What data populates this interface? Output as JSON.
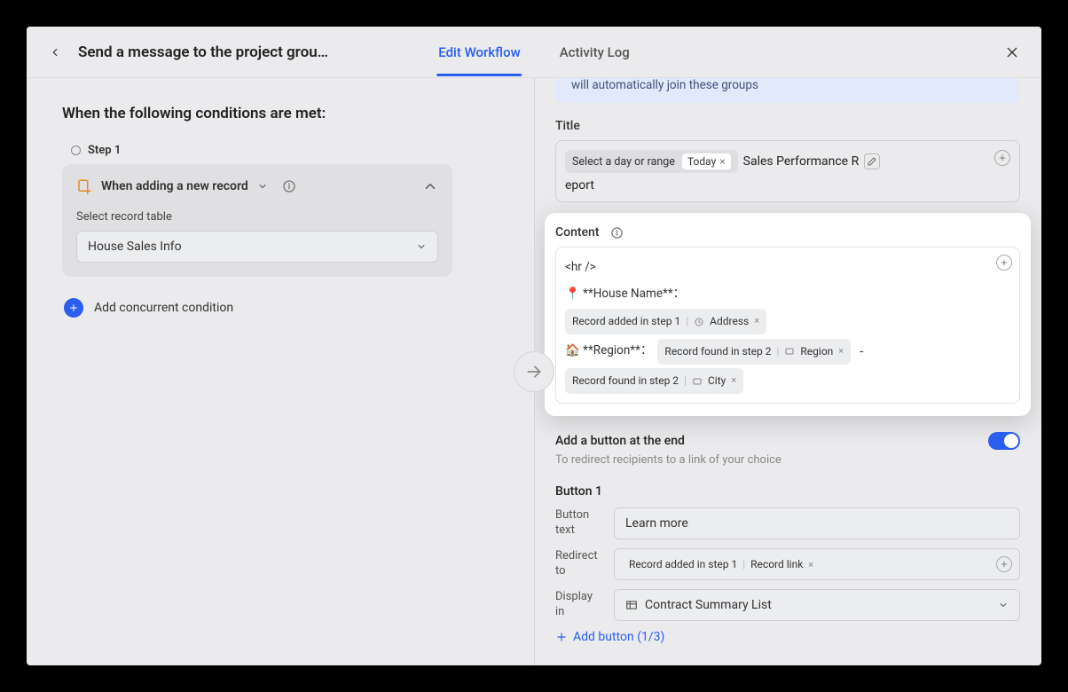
{
  "header": {
    "title": "Send a message to the project grou…",
    "tab_edit": "Edit Workflow",
    "tab_log": "Activity Log"
  },
  "left": {
    "conditions_title": "When the following conditions are met:",
    "step_label": "Step 1",
    "trigger_label": "When adding a new record",
    "select_label": "Select record table",
    "select_value": "House Sales Info",
    "add_condition": "Add concurrent condition"
  },
  "right": {
    "banner_text": "will automatically join these groups",
    "title_label": "Title",
    "title_token": "Select a day or range",
    "title_sub": "Today",
    "title_plain1": "Sales Performance R",
    "title_plain2": "eport",
    "content_label": "Content",
    "content_hr": "<hr />",
    "house_line": "📍 **House Name**：",
    "region_line": "🏠 **Region**：",
    "rec_step1": "Record added in step 1",
    "rec_step2": "Record found in step 2",
    "field_address": "Address",
    "field_region": "Region",
    "field_city": "City",
    "field_reclink": "Record link",
    "toggle_title": "Add a button at the end",
    "toggle_sub": "To redirect recipients to a link of your choice",
    "button_title": "Button 1",
    "btn_text_label": "Button text",
    "btn_text_value": "Learn more",
    "redirect_label": "Redirect to",
    "display_label": "Display in",
    "display_value": "Contract Summary List",
    "add_button": "Add button (1/3)"
  }
}
